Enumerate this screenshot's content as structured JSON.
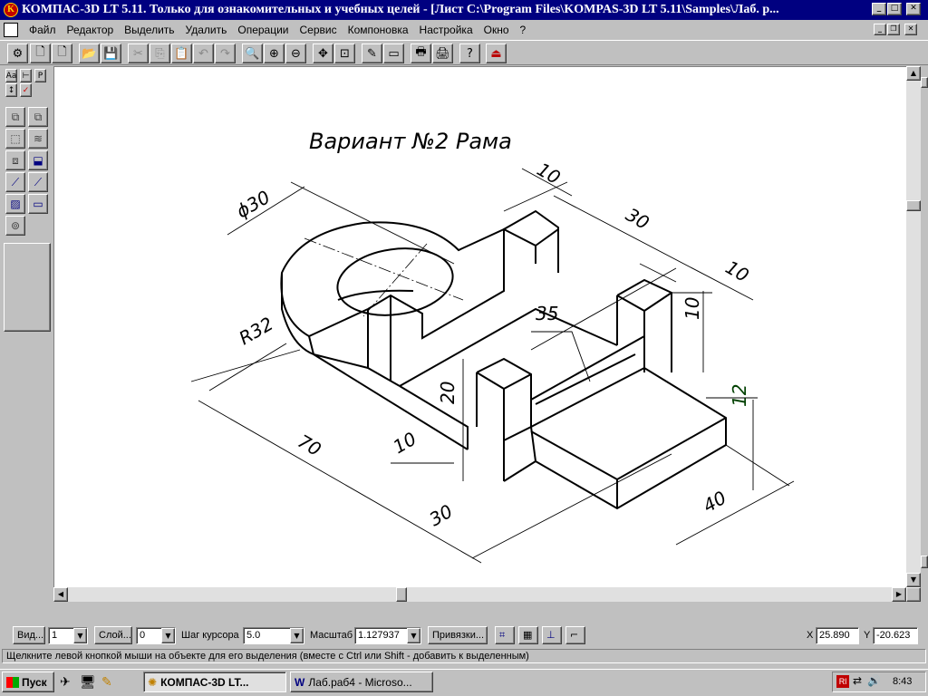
{
  "window": {
    "title": "КОМПАС-3D LT 5.11. Только для ознакомительных и учебных целей - [Лист C:\\Program Files\\KOMPAS-3D LT 5.11\\Samples\\Лаб. р...",
    "app_icon": "kompas-logo-icon"
  },
  "menu": {
    "items": [
      "Файл",
      "Редактор",
      "Выделить",
      "Удалить",
      "Операции",
      "Сервис",
      "Компоновка",
      "Настройка",
      "Окно",
      "?"
    ]
  },
  "left_panel": {
    "small_tabs": [
      "Aa",
      "⊢",
      "P"
    ]
  },
  "drawing": {
    "title": "Вариант №2   Рама",
    "dimensions": {
      "d30": "ϕ30",
      "r32": "R32",
      "top10": "10",
      "top30": "30",
      "right10a": "10",
      "right10b": "10",
      "h35": "35",
      "h20": "20",
      "h12": "12",
      "h10": "10",
      "l70": "70",
      "l30": "30",
      "w40": "40"
    }
  },
  "status": {
    "view_button": "Вид...",
    "view_value": "1",
    "layer_button": "Слой...",
    "layer_value": "0",
    "cursor_step_label": "Шаг курсора",
    "cursor_step_value": "5.0",
    "scale_label": "Масштаб",
    "scale_value": "1.127937",
    "snaps_button": "Привязки...",
    "x_label": "X",
    "x_value": "25.890",
    "y_label": "Y",
    "y_value": "-20.623",
    "hint": "Щелкните левой кнопкой мыши на объекте для его выделения (вместе с Ctrl или Shift - добавить к выделенным)"
  },
  "taskbar": {
    "start": "Пуск",
    "tasks": [
      "КОМПАС-3D LT...",
      "Лаб.раб4 - Microso..."
    ],
    "tray_lang": "Rl",
    "clock": "8:43"
  }
}
